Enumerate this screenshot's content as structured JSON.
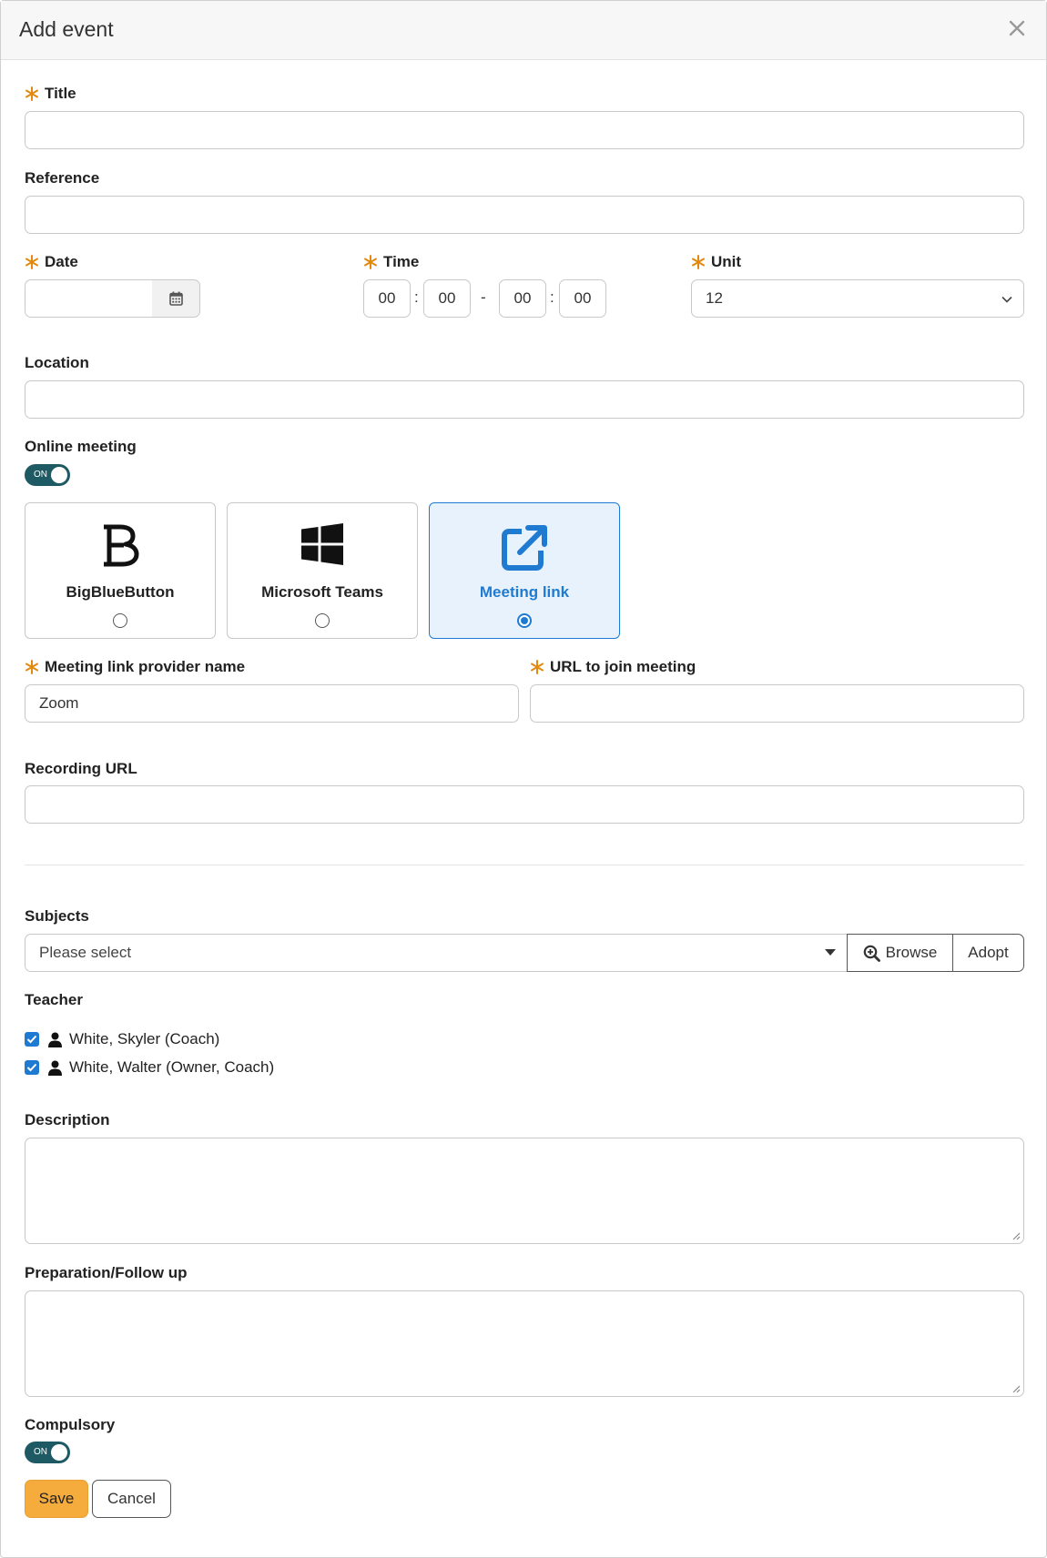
{
  "modal": {
    "title": "Add event",
    "close_icon": "close-icon"
  },
  "fields": {
    "title_label": "Title",
    "reference_label": "Reference",
    "date_label": "Date",
    "time_label": "Time",
    "time_start_hour": "00",
    "time_start_min": "00",
    "time_dash": "-",
    "time_colon": ":",
    "time_end_hour": "00",
    "time_end_min": "00",
    "unit_label": "Unit",
    "unit_value": "12",
    "location_label": "Location",
    "online_meeting_label": "Online meeting",
    "online_meeting_toggle": "ON",
    "meeting_provider_label": "Meeting link provider name",
    "meeting_provider_value": "Zoom",
    "join_url_label": "URL to join meeting",
    "recording_url_label": "Recording URL"
  },
  "meeting_options": [
    {
      "label": "BigBlueButton",
      "icon": "bigbluebutton-icon",
      "selected": false
    },
    {
      "label": "Microsoft Teams",
      "icon": "windows-icon",
      "selected": false
    },
    {
      "label": "Meeting link",
      "icon": "external-link-icon",
      "selected": true
    }
  ],
  "subjects": {
    "label": "Subjects",
    "placeholder": "Please select",
    "browse_label": "Browse",
    "adopt_label": "Adopt"
  },
  "teacher": {
    "label": "Teacher",
    "items": [
      {
        "name": "White, Skyler (Coach)",
        "checked": true
      },
      {
        "name": "White, Walter (Owner, Coach)",
        "checked": true
      }
    ]
  },
  "description_label": "Description",
  "preparation_label": "Preparation/Follow up",
  "compulsory": {
    "label": "Compulsory",
    "toggle": "ON"
  },
  "actions": {
    "save_label": "Save",
    "cancel_label": "Cancel"
  },
  "colors": {
    "required": "#e3890f",
    "accent": "#1f7bd1",
    "toggle": "#1e5a63",
    "save": "#f5ac3d"
  }
}
